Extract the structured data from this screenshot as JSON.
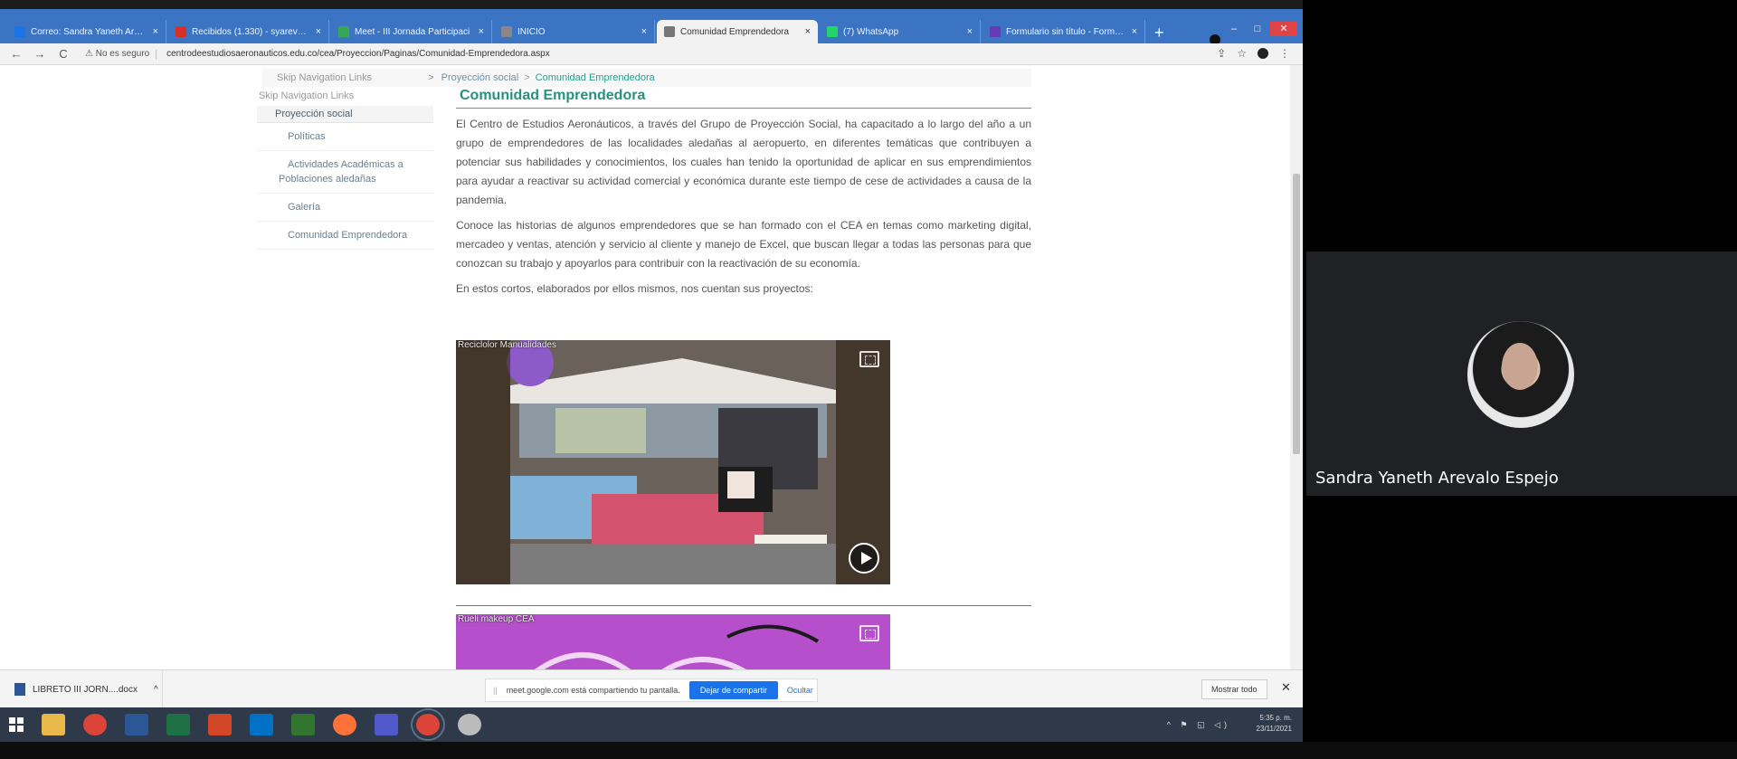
{
  "browser": {
    "tabs": [
      {
        "label": "Correo: Sandra Yaneth Arevalo E",
        "color": "#1a73e8",
        "active": false
      },
      {
        "label": "Recibidos (1.330) - syarevalo@",
        "color": "#d93025",
        "active": false
      },
      {
        "label": "Meet - III Jornada Participaci",
        "color": "#34a853",
        "active": false
      },
      {
        "label": "INICIO",
        "color": "#888888",
        "active": false
      },
      {
        "label": "Comunidad Emprendedora",
        "color": "#777777",
        "active": true
      },
      {
        "label": "(7) WhatsApp",
        "color": "#25d366",
        "active": false
      },
      {
        "label": "Formulario sin título - Formular",
        "color": "#673ab7",
        "active": false
      }
    ],
    "tab_close": "×",
    "new_tab": "+",
    "window_controls": {
      "minimize": "–",
      "maximize": "□",
      "close": "✕"
    },
    "security_label": "No es seguro",
    "url": "centrodeestudiosaeronauticos.edu.co/cea/Proyeccion/Paginas/Comunidad-Emprendedora.aspx",
    "nav": {
      "back": "←",
      "forward": "→",
      "reload": "C"
    },
    "toolbar_icons": {
      "share": "⇪",
      "star": "☆",
      "menu": "⋮"
    }
  },
  "page": {
    "breadcrumb": {
      "skip_links": "Skip Navigation Links",
      "separator": ">",
      "items": [
        "Proyección social",
        "Comunidad Emprendedora"
      ]
    },
    "left_nav": {
      "skip_links": "Skip Navigation Links",
      "root": "Proyección social",
      "items": [
        "Políticas",
        "Actividades Académicas a Poblaciones aledañas",
        "Galería",
        "Comunidad Emprendedora"
      ]
    },
    "title": "Comunidad Emprendedora",
    "paragraphs": [
      "El Centro de Estudios Aeronáuticos, a través del Grupo de Proyección Social, ha capacitado a lo largo del año a un grupo de emprendedores de las localidades aledañas al aeropuerto, en diferentes temáticas que contribuyen a potenciar sus habilidades y conocimientos, los cuales han tenido la oportunidad de aplicar en sus emprendimientos para ayudar a reactivar su actividad comercial y económica durante este tiempo de cese de actividades a causa de la pandemia.",
      "Conoce las historias de algunos emprendedores que se han formado con el CEA en temas como marketing digital, mercadeo y ventas, atención y servicio al cliente y manejo de Excel, que buscan llegar a todas las personas para que conozcan su trabajo y apoyarlos para contribuir con la reactivación de su economía.",
      "En estos cortos, elaborados por ellos mismos, nos cuentan sus proyectos:"
    ],
    "videos": [
      {
        "title": "Reciclolor Manualidades"
      },
      {
        "title": "Rueli makeup CEA"
      }
    ]
  },
  "downloads": {
    "file": "LIBRETO III JORN....docx",
    "chevron": "^",
    "sharing_text": "meet.google.com está compartiendo tu pantalla.",
    "stop_sharing": "Dejar de compartir",
    "hide": "Ocultar",
    "show_all": "Mostrar todo",
    "close": "✕"
  },
  "taskbar": {
    "apps": [
      {
        "name": "file-explorer",
        "color": "#e8b84a"
      },
      {
        "name": "chrome",
        "color": "#db4437"
      },
      {
        "name": "word",
        "color": "#2b5797"
      },
      {
        "name": "excel",
        "color": "#1e7145"
      },
      {
        "name": "powerpoint",
        "color": "#d24726"
      },
      {
        "name": "outlook",
        "color": "#0072c6"
      },
      {
        "name": "project",
        "color": "#31752f"
      },
      {
        "name": "firefox",
        "color": "#ff7139"
      },
      {
        "name": "teams",
        "color": "#5059c9"
      },
      {
        "name": "chrome-active",
        "color": "#db4437"
      },
      {
        "name": "itunes",
        "color": "#bbbbbb"
      }
    ],
    "time": "5:35 p. m.",
    "date": "23/11/2021"
  },
  "meet": {
    "participant_name": "Sandra Yaneth Arevalo Espejo"
  }
}
